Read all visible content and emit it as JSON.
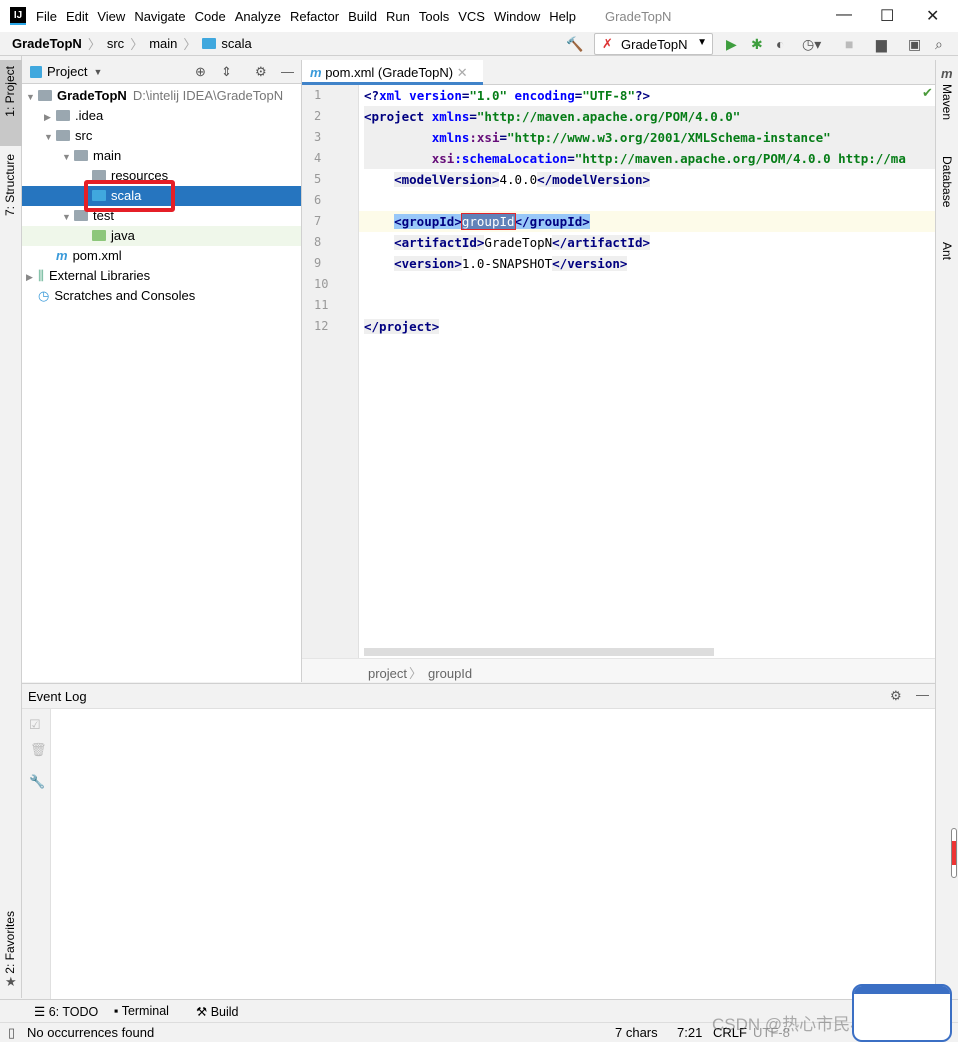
{
  "app": {
    "title": "GradeTopN",
    "menu": [
      "File",
      "Edit",
      "View",
      "Navigate",
      "Code",
      "Analyze",
      "Refactor",
      "Build",
      "Run",
      "Tools",
      "VCS",
      "Window",
      "Help"
    ]
  },
  "navbar": {
    "crumbs": [
      "GradeTopN",
      "src",
      "main",
      "scala"
    ],
    "run_config": "GradeTopN"
  },
  "left_tabs": {
    "project": "1: Project",
    "structure": "7: Structure",
    "favorites": "2: Favorites"
  },
  "right_tabs": {
    "maven": "Maven",
    "database": "Database",
    "ant": "Ant"
  },
  "project": {
    "title": "Project",
    "tree": [
      {
        "label": "GradeTopN",
        "path": "D:\\intelij IDEA\\GradeTopN",
        "arrow": "▼",
        "depth": 0,
        "icon": "module"
      },
      {
        "label": ".idea",
        "arrow": "▶",
        "depth": 1,
        "icon": "folder"
      },
      {
        "label": "src",
        "arrow": "▼",
        "depth": 1,
        "icon": "folder"
      },
      {
        "label": "main",
        "arrow": "▼",
        "depth": 2,
        "icon": "folder"
      },
      {
        "label": "resources",
        "arrow": "",
        "depth": 3,
        "icon": "folder"
      },
      {
        "label": "scala",
        "arrow": "",
        "depth": 3,
        "icon": "folder-blue",
        "selected": true
      },
      {
        "label": "test",
        "arrow": "▼",
        "depth": 2,
        "icon": "folder"
      },
      {
        "label": "java",
        "arrow": "",
        "depth": 3,
        "icon": "folder-green"
      },
      {
        "label": "pom.xml",
        "arrow": "",
        "depth": 1,
        "icon": "maven"
      },
      {
        "label": "External Libraries",
        "arrow": "▶",
        "depth": 0,
        "icon": "libraries"
      },
      {
        "label": "Scratches and Consoles",
        "arrow": "",
        "depth": 0,
        "icon": "scratches"
      }
    ]
  },
  "editor": {
    "tab": "pom.xml (GradeTopN)",
    "breadcrumb": [
      "project",
      "groupId"
    ],
    "lines": [
      [
        [
          "tag",
          "<?"
        ],
        [
          "attr",
          "xml "
        ],
        [
          "attr",
          "version"
        ],
        [
          "tag",
          "="
        ],
        [
          "str",
          "\"1.0\" "
        ],
        [
          "attr",
          "encoding"
        ],
        [
          "tag",
          "="
        ],
        [
          "str",
          "\"UTF-8\""
        ],
        [
          "tag",
          "?>"
        ]
      ],
      [
        [
          "tag",
          "<project "
        ],
        [
          "attr",
          "xmlns"
        ],
        [
          "tag",
          "="
        ],
        [
          "str",
          "\"http://maven.apache.org/POM/4.0.0\""
        ]
      ],
      [
        [
          "txt",
          "         "
        ],
        [
          "attr",
          "xmlns"
        ],
        [
          "ns",
          ":xsi"
        ],
        [
          "tag",
          "="
        ],
        [
          "str",
          "\"http://www.w3.org/2001/XMLSchema-instance\""
        ]
      ],
      [
        [
          "txt",
          "         "
        ],
        [
          "ns",
          "xsi"
        ],
        [
          "attr",
          ":schemaLocation"
        ],
        [
          "tag",
          "="
        ],
        [
          "str",
          "\"http://maven.apache.org/POM/4.0.0 http://ma"
        ]
      ],
      [
        [
          "txt",
          "    "
        ],
        [
          "tag",
          "<modelVersion>"
        ],
        [
          "txt",
          "4.0.0"
        ],
        [
          "tag",
          "</modelVersion>"
        ]
      ],
      [],
      [
        [
          "txt",
          "    "
        ],
        [
          "tagh",
          "<groupId>"
        ],
        [
          "sel",
          "groupId"
        ],
        [
          "tagh",
          "</groupId>"
        ]
      ],
      [
        [
          "txt",
          "    "
        ],
        [
          "tag",
          "<artifactId>"
        ],
        [
          "txt",
          "GradeTopN"
        ],
        [
          "tag",
          "</artifactId>"
        ]
      ],
      [
        [
          "txt",
          "    "
        ],
        [
          "tag",
          "<version>"
        ],
        [
          "txt",
          "1.0-SNAPSHOT"
        ],
        [
          "tag",
          "</version>"
        ]
      ],
      [],
      [],
      [
        [
          "tag",
          "</project>"
        ]
      ]
    ]
  },
  "event_log": {
    "title": "Event Log"
  },
  "bottom_tabs": [
    "6: TODO",
    "Terminal",
    "Build"
  ],
  "status": {
    "message": "No occurrences found",
    "chars": "7 chars",
    "position": "7:21",
    "line_sep": "CRLF",
    "encoding": "UTF-8"
  },
  "watermark": "CSDN @热心市民小李同学"
}
